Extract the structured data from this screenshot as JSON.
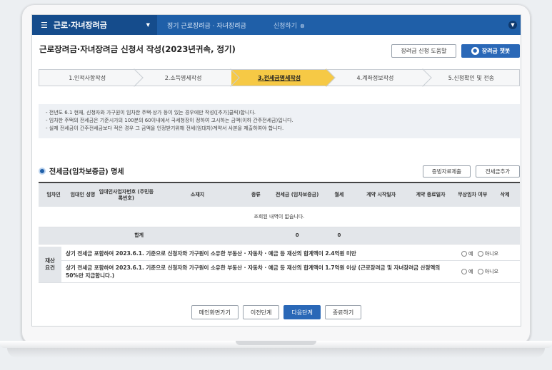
{
  "nav": {
    "main_menu": "근로·자녀장려금",
    "breadcrumb_1": "정기 근로장려금 · 자녀장려금",
    "breadcrumb_2": "신청하기"
  },
  "page": {
    "title": "근로장려금·자녀장려금 신청서 작성(2023년귀속, 정기)",
    "help_button": "장려금 신청 도움말",
    "chatbot_button": "장려금 챗봇"
  },
  "steps": [
    {
      "label": "1.인적사항작성",
      "active": false
    },
    {
      "label": "2.소득명세작성",
      "active": false
    },
    {
      "label": "3.전세금명세작성",
      "active": true
    },
    {
      "label": "4.계좌정보작성",
      "active": false
    },
    {
      "label": "5.신청확인 및 전송",
      "active": false
    }
  ],
  "notice": [
    "전년도 6.1 현재, 신청자와 가구원이 임차한 주택·상가 등이 있는 경우에만 작성([추가]클릭)합니다.",
    "임차한 주택의 전세금은 기준시가의 100분의 60이내에서 국세청장이 정하여 고시하는 금액(이하 간주전세금)입니다.",
    "실제 전세금이 간주전세금보다 적은 경우 그 금액을 인정받기위해 전세(임대차)계약서 사본을 제출하여야 합니다."
  ],
  "section": {
    "title": "전세금(임차보증금) 명세",
    "evidence_button": "증빙자료제출",
    "add_button": "전세금추가"
  },
  "table": {
    "headers": [
      "임차인",
      "임대인 성명",
      "임대인사업자번호 (주민등록번호)",
      "소재지",
      "종류",
      "전세금 (임차보증금)",
      "월세",
      "계약 시작일자",
      "계약 종료일자",
      "무상임차 여부",
      "삭제"
    ],
    "empty_message": "조회된 내역이 없습니다.",
    "sum_label": "합계",
    "sum_deposit": "0",
    "sum_rent": "0"
  },
  "conditions": {
    "label": "재산 요건",
    "items": [
      {
        "text": "상기 전세금 포함하여 2023.6.1. 기준으로 신청자와 가구원이 소유한 부동산 · 자동차 · 예금 등 재산의 합계액이 2.4억원 미만",
        "yes": "예",
        "no": "아니오"
      },
      {
        "text": "상기 전세금 포함하여 2023.6.1. 기준으로 신청자와 가구원이 소유한 부동산 · 자동차 · 예금 등 재산의 합계액이 1.7억원 이상 (근로장려금 및 자녀장려금 산정액의 50%만 지급합니다.)",
        "yes": "예",
        "no": "아니오"
      }
    ]
  },
  "buttons": {
    "home": "메인화면가기",
    "prev": "이전단계",
    "next": "다음단계",
    "exit": "종료하기"
  }
}
